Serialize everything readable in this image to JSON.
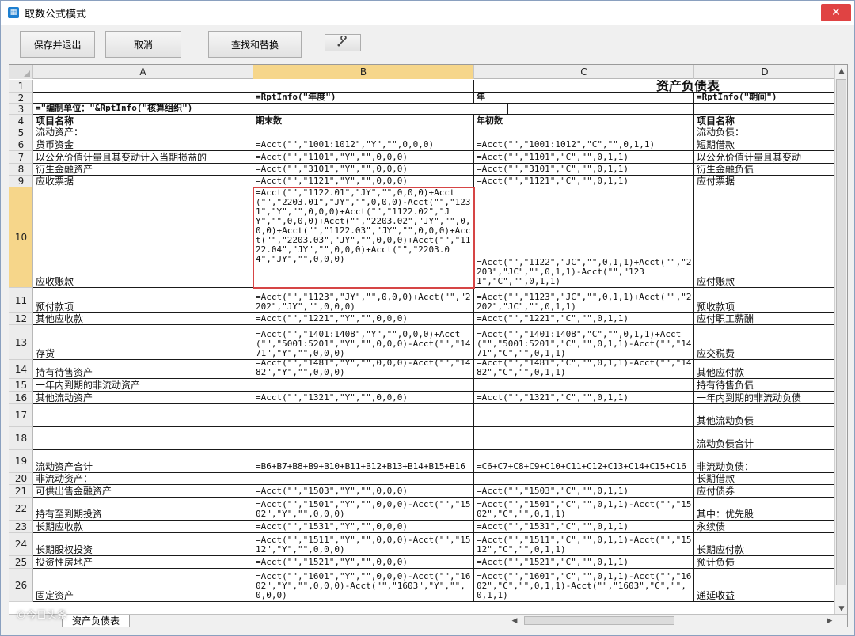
{
  "window": {
    "title": "取数公式模式",
    "app_icon": "excel-app-icon",
    "minimize": "—",
    "maximize": "☐",
    "close": "✕"
  },
  "toolbar": {
    "save_exit": "保存并退出",
    "cancel": "取消",
    "find_replace": "查找和替换",
    "tool_icon": "wrench-icon"
  },
  "columns": [
    "A",
    "B",
    "C",
    "D"
  ],
  "selected_column": "B",
  "selected_row": "10",
  "rows": [
    {
      "num": "1",
      "a": "",
      "b": "",
      "c": "资产负债表",
      "d": ""
    },
    {
      "num": "2",
      "a": "",
      "b": "=RptInfo(\"年度\")",
      "c": "年",
      "d": "=RptInfo(\"期间\")"
    },
    {
      "num": "3",
      "a": "=\"编制单位：\"&RptInfo(\"核算组织\")",
      "b": "",
      "c": "",
      "d": ""
    },
    {
      "num": "4",
      "a": "项目名称",
      "b": "期末数",
      "c": "年初数",
      "d": "项目名称"
    },
    {
      "num": "5",
      "a": "流动资产：",
      "b": "",
      "c": "",
      "d": "流动负债："
    },
    {
      "num": "6",
      "a": "    货币资金",
      "b": "=Acct(\"\",\"1001:1012\",\"Y\",\"\",0,0,0)",
      "c": "=Acct(\"\",\"1001:1012\",\"C\",\"\",0,1,1)",
      "d": "    短期借款"
    },
    {
      "num": "7",
      "a": "    以公允价值计量且其变动计入当期损益的",
      "b": "=Acct(\"\",\"1101\",\"Y\",\"\",0,0,0)",
      "c": "=Acct(\"\",\"1101\",\"C\",\"\",0,1,1)",
      "d": "    以公允价值计量且其变动"
    },
    {
      "num": "8",
      "a": "    衍生金融资产",
      "b": "=Acct(\"\",\"3101\",\"Y\",\"\",0,0,0)",
      "c": "=Acct(\"\",\"3101\",\"C\",\"\",0,1,1)",
      "d": "    衍生金融负债"
    },
    {
      "num": "9",
      "a": "    应收票据",
      "b": "=Acct(\"\",\"1121\",\"Y\",\"\",0,0,0)",
      "c": "=Acct(\"\",\"1121\",\"C\",\"\",0,1,1)",
      "d": "    应付票据"
    },
    {
      "num": "10",
      "a": "    应收账款",
      "b": "=Acct(\"\",\"1122.01\",\"JY\",\"\",0,0,0)+Acct(\"\",\"2203.01\",\"JY\",\"\",0,0,0)-Acct(\"\",\"1231\",\"Y\",\"\",0,0,0)+Acct(\"\",\"1122.02\",\"JY\",\"\",0,0,0)+Acct(\"\",\"2203.02\",\"JY\",\"\",0,0,0)+Acct(\"\",\"1122.03\",\"JY\",\"\",0,0,0)+Acct(\"\",\"2203.03\",\"JY\",\"\",0,0,0)+Acct(\"\",\"1122.04\",\"JY\",\"\",0,0,0)+Acct(\"\",\"2203.04\",\"JY\",\"\",0,0,0)",
      "c": "=Acct(\"\",\"1122\",\"JC\",\"\",0,1,1)+Acct(\"\",\"2203\",\"JC\",\"\",0,1,1)-Acct(\"\",\"1231\",\"C\",\"\",0,1,1)",
      "d": "    应付账款"
    },
    {
      "num": "11",
      "a": "    预付款项",
      "b": "=Acct(\"\",\"1123\",\"JY\",\"\",0,0,0)+Acct(\"\",\"2202\",\"JY\",\"\",0,0,0)",
      "c": "=Acct(\"\",\"1123\",\"JC\",\"\",0,1,1)+Acct(\"\",\"2202\",\"JC\",\"\",0,1,1)",
      "d": "    预收款项"
    },
    {
      "num": "12",
      "a": "    其他应收款",
      "b": "=Acct(\"\",\"1221\",\"Y\",\"\",0,0,0)",
      "c": "=Acct(\"\",\"1221\",\"C\",\"\",0,1,1)",
      "d": "    应付职工薪酬"
    },
    {
      "num": "13",
      "a": "    存货",
      "b": "=Acct(\"\",\"1401:1408\",\"Y\",\"\",0,0,0)+Acct(\"\",\"5001:5201\",\"Y\",\"\",0,0,0)-Acct(\"\",\"1471\",\"Y\",\"\",0,0,0)",
      "c": "=Acct(\"\",\"1401:1408\",\"C\",\"\",0,1,1)+Acct(\"\",\"5001:5201\",\"C\",\"\",0,1,1)-Acct(\"\",\"1471\",\"C\",\"\",0,1,1)",
      "d": "    应交税费"
    },
    {
      "num": "14",
      "a": "    持有待售资产",
      "b": "=Acct(\"\",\"1481\",\"Y\",\"\",0,0,0)-Acct(\"\",\"1482\",\"Y\",\"\",0,0,0)",
      "c": "=Acct(\"\",\"1481\",\"C\",\"\",0,1,1)-Acct(\"\",\"1482\",\"C\",\"\",0,1,1)",
      "d": "    其他应付款"
    },
    {
      "num": "15",
      "a": "    一年内到期的非流动资产",
      "b": "",
      "c": "",
      "d": "    持有待售负债"
    },
    {
      "num": "16",
      "a": "    其他流动资产",
      "b": "=Acct(\"\",\"1321\",\"Y\",\"\",0,0,0)",
      "c": "=Acct(\"\",\"1321\",\"C\",\"\",0,1,1)",
      "d": "    一年内到期的非流动负债"
    },
    {
      "num": "17",
      "a": "",
      "b": "",
      "c": "",
      "d": "    其他流动负债"
    },
    {
      "num": "18",
      "a": "",
      "b": "",
      "c": "",
      "d": "        流动负债合计"
    },
    {
      "num": "19",
      "a": "        流动资产合计",
      "b": "=B6+B7+B8+B9+B10+B11+B12+B13+B14+B15+B16",
      "c": "=C6+C7+C8+C9+C10+C11+C12+C13+C14+C15+C16",
      "d": "非流动负债："
    },
    {
      "num": "20",
      "a": "非流动资产：",
      "b": "",
      "c": "",
      "d": "    长期借款"
    },
    {
      "num": "21",
      "a": "    可供出售金融资产",
      "b": "=Acct(\"\",\"1503\",\"Y\",\"\",0,0,0)",
      "c": "=Acct(\"\",\"1503\",\"C\",\"\",0,1,1)",
      "d": "    应付债券"
    },
    {
      "num": "22",
      "a": "    持有至到期投资",
      "b": "=Acct(\"\",\"1501\",\"Y\",\"\",0,0,0)-Acct(\"\",\"1502\",\"Y\",\"\",0,0,0)",
      "c": "=Acct(\"\",\"1501\",\"C\",\"\",0,1,1)-Acct(\"\",\"1502\",\"C\",\"\",0,1,1)",
      "d": "        其中：优先股"
    },
    {
      "num": "23",
      "a": "    长期应收款",
      "b": "=Acct(\"\",\"1531\",\"Y\",\"\",0,0,0)",
      "c": "=Acct(\"\",\"1531\",\"C\",\"\",0,1,1)",
      "d": "              永续债"
    },
    {
      "num": "24",
      "a": "    长期股权投资",
      "b": "=Acct(\"\",\"1511\",\"Y\",\"\",0,0,0)-Acct(\"\",\"1512\",\"Y\",\"\",0,0,0)",
      "c": "=Acct(\"\",\"1511\",\"C\",\"\",0,1,1)-Acct(\"\",\"1512\",\"C\",\"\",0,1,1)",
      "d": "    长期应付款"
    },
    {
      "num": "25",
      "a": "    投资性房地产",
      "b": "=Acct(\"\",\"1521\",\"Y\",\"\",0,0,0)",
      "c": "=Acct(\"\",\"1521\",\"C\",\"\",0,1,1)",
      "d": "    预计负债"
    },
    {
      "num": "26",
      "a": "    固定资产",
      "b": "=Acct(\"\",\"1601\",\"Y\",\"\",0,0,0)-Acct(\"\",\"1602\",\"Y\",\"\",0,0,0)-Acct(\"\",\"1603\",\"Y\",\"\",0,0,0)",
      "c": "=Acct(\"\",\"1601\",\"C\",\"\",0,1,1)-Acct(\"\",\"1602\",\"C\",\"\",0,1,1)-Acct(\"\",\"1603\",\"C\",\"\",0,1,1)",
      "d": "    递延收益"
    }
  ],
  "sheet_tab": "资产负债表",
  "watermark": "©今日头条 ",
  "accent_selection": "#d64545",
  "accent_header_sel": "#f6d68a"
}
